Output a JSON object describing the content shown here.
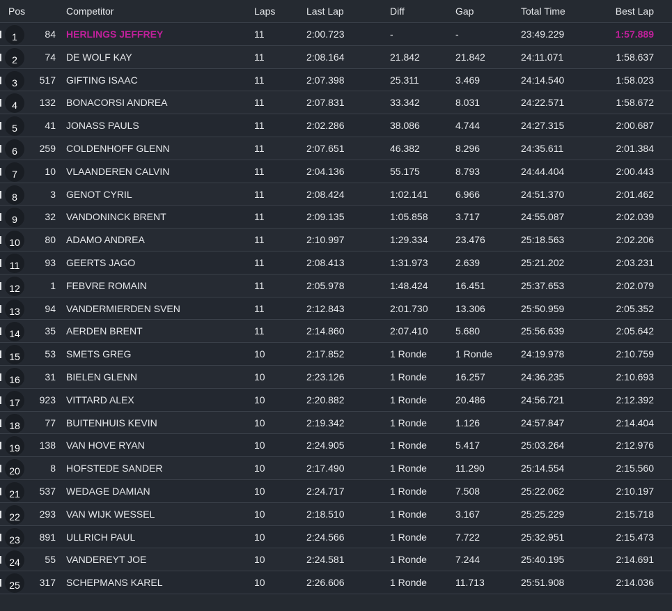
{
  "header": {
    "pos": "Pos",
    "competitor": "Competitor",
    "laps": "Laps",
    "last_lap": "Last Lap",
    "diff": "Diff",
    "gap": "Gap",
    "total_time": "Total Time",
    "best_lap": "Best Lap"
  },
  "colors": {
    "background": "#252a31",
    "highlight": "#c0209b",
    "text": "#e6e8eb",
    "position_badge": "#191d23"
  },
  "rows": [
    {
      "pos": "1",
      "num": "84",
      "name": "HERLINGS JEFFREY",
      "laps": "11",
      "last": "2:00.723",
      "diff": "-",
      "gap": "-",
      "total": "23:49.229",
      "best": "1:57.889",
      "leader": true,
      "best_overall": true
    },
    {
      "pos": "2",
      "num": "74",
      "name": "DE WOLF KAY",
      "laps": "11",
      "last": "2:08.164",
      "diff": "21.842",
      "gap": "21.842",
      "total": "24:11.071",
      "best": "1:58.637"
    },
    {
      "pos": "3",
      "num": "517",
      "name": "GIFTING ISAAC",
      "laps": "11",
      "last": "2:07.398",
      "diff": "25.311",
      "gap": "3.469",
      "total": "24:14.540",
      "best": "1:58.023"
    },
    {
      "pos": "4",
      "num": "132",
      "name": "BONACORSI ANDREA",
      "laps": "11",
      "last": "2:07.831",
      "diff": "33.342",
      "gap": "8.031",
      "total": "24:22.571",
      "best": "1:58.672"
    },
    {
      "pos": "5",
      "num": "41",
      "name": "JONASS PAULS",
      "laps": "11",
      "last": "2:02.286",
      "diff": "38.086",
      "gap": "4.744",
      "total": "24:27.315",
      "best": "2:00.687"
    },
    {
      "pos": "6",
      "num": "259",
      "name": "COLDENHOFF GLENN",
      "laps": "11",
      "last": "2:07.651",
      "diff": "46.382",
      "gap": "8.296",
      "total": "24:35.611",
      "best": "2:01.384"
    },
    {
      "pos": "7",
      "num": "10",
      "name": "VLAANDEREN CALVIN",
      "laps": "11",
      "last": "2:04.136",
      "diff": "55.175",
      "gap": "8.793",
      "total": "24:44.404",
      "best": "2:00.443"
    },
    {
      "pos": "8",
      "num": "3",
      "name": "GENOT CYRIL",
      "laps": "11",
      "last": "2:08.424",
      "diff": "1:02.141",
      "gap": "6.966",
      "total": "24:51.370",
      "best": "2:01.462"
    },
    {
      "pos": "9",
      "num": "32",
      "name": "VANDONINCK BRENT",
      "laps": "11",
      "last": "2:09.135",
      "diff": "1:05.858",
      "gap": "3.717",
      "total": "24:55.087",
      "best": "2:02.039"
    },
    {
      "pos": "10",
      "num": "80",
      "name": "ADAMO ANDREA",
      "laps": "11",
      "last": "2:10.997",
      "diff": "1:29.334",
      "gap": "23.476",
      "total": "25:18.563",
      "best": "2:02.206"
    },
    {
      "pos": "11",
      "num": "93",
      "name": "GEERTS JAGO",
      "laps": "11",
      "last": "2:08.413",
      "diff": "1:31.973",
      "gap": "2.639",
      "total": "25:21.202",
      "best": "2:03.231"
    },
    {
      "pos": "12",
      "num": "1",
      "name": "FEBVRE ROMAIN",
      "laps": "11",
      "last": "2:05.978",
      "diff": "1:48.424",
      "gap": "16.451",
      "total": "25:37.653",
      "best": "2:02.079"
    },
    {
      "pos": "13",
      "num": "94",
      "name": "VANDERMIERDEN SVEN",
      "laps": "11",
      "last": "2:12.843",
      "diff": "2:01.730",
      "gap": "13.306",
      "total": "25:50.959",
      "best": "2:05.352"
    },
    {
      "pos": "14",
      "num": "35",
      "name": "AERDEN BRENT",
      "laps": "11",
      "last": "2:14.860",
      "diff": "2:07.410",
      "gap": "5.680",
      "total": "25:56.639",
      "best": "2:05.642"
    },
    {
      "pos": "15",
      "num": "53",
      "name": "SMETS GREG",
      "laps": "10",
      "last": "2:17.852",
      "diff": "1 Ronde",
      "gap": "1 Ronde",
      "total": "24:19.978",
      "best": "2:10.759"
    },
    {
      "pos": "16",
      "num": "31",
      "name": "BIELEN GLENN",
      "laps": "10",
      "last": "2:23.126",
      "diff": "1 Ronde",
      "gap": "16.257",
      "total": "24:36.235",
      "best": "2:10.693"
    },
    {
      "pos": "17",
      "num": "923",
      "name": "VITTARD ALEX",
      "laps": "10",
      "last": "2:20.882",
      "diff": "1 Ronde",
      "gap": "20.486",
      "total": "24:56.721",
      "best": "2:12.392"
    },
    {
      "pos": "18",
      "num": "77",
      "name": "BUITENHUIS KEVIN",
      "laps": "10",
      "last": "2:19.342",
      "diff": "1 Ronde",
      "gap": "1.126",
      "total": "24:57.847",
      "best": "2:14.404"
    },
    {
      "pos": "19",
      "num": "138",
      "name": "VAN HOVE RYAN",
      "laps": "10",
      "last": "2:24.905",
      "diff": "1 Ronde",
      "gap": "5.417",
      "total": "25:03.264",
      "best": "2:12.976"
    },
    {
      "pos": "20",
      "num": "8",
      "name": "HOFSTEDE SANDER",
      "laps": "10",
      "last": "2:17.490",
      "diff": "1 Ronde",
      "gap": "11.290",
      "total": "25:14.554",
      "best": "2:15.560"
    },
    {
      "pos": "21",
      "num": "537",
      "name": "WEDAGE DAMIAN",
      "laps": "10",
      "last": "2:24.717",
      "diff": "1 Ronde",
      "gap": "7.508",
      "total": "25:22.062",
      "best": "2:10.197"
    },
    {
      "pos": "22",
      "num": "293",
      "name": "VAN WIJK WESSEL",
      "laps": "10",
      "last": "2:18.510",
      "diff": "1 Ronde",
      "gap": "3.167",
      "total": "25:25.229",
      "best": "2:15.718"
    },
    {
      "pos": "23",
      "num": "891",
      "name": "ULLRICH PAUL",
      "laps": "10",
      "last": "2:24.566",
      "diff": "1 Ronde",
      "gap": "7.722",
      "total": "25:32.951",
      "best": "2:15.473"
    },
    {
      "pos": "24",
      "num": "55",
      "name": "VANDEREYT JOE",
      "laps": "10",
      "last": "2:24.581",
      "diff": "1 Ronde",
      "gap": "7.244",
      "total": "25:40.195",
      "best": "2:14.691"
    },
    {
      "pos": "25",
      "num": "317",
      "name": "SCHEPMANS KAREL",
      "laps": "10",
      "last": "2:26.606",
      "diff": "1 Ronde",
      "gap": "11.713",
      "total": "25:51.908",
      "best": "2:14.036"
    }
  ]
}
